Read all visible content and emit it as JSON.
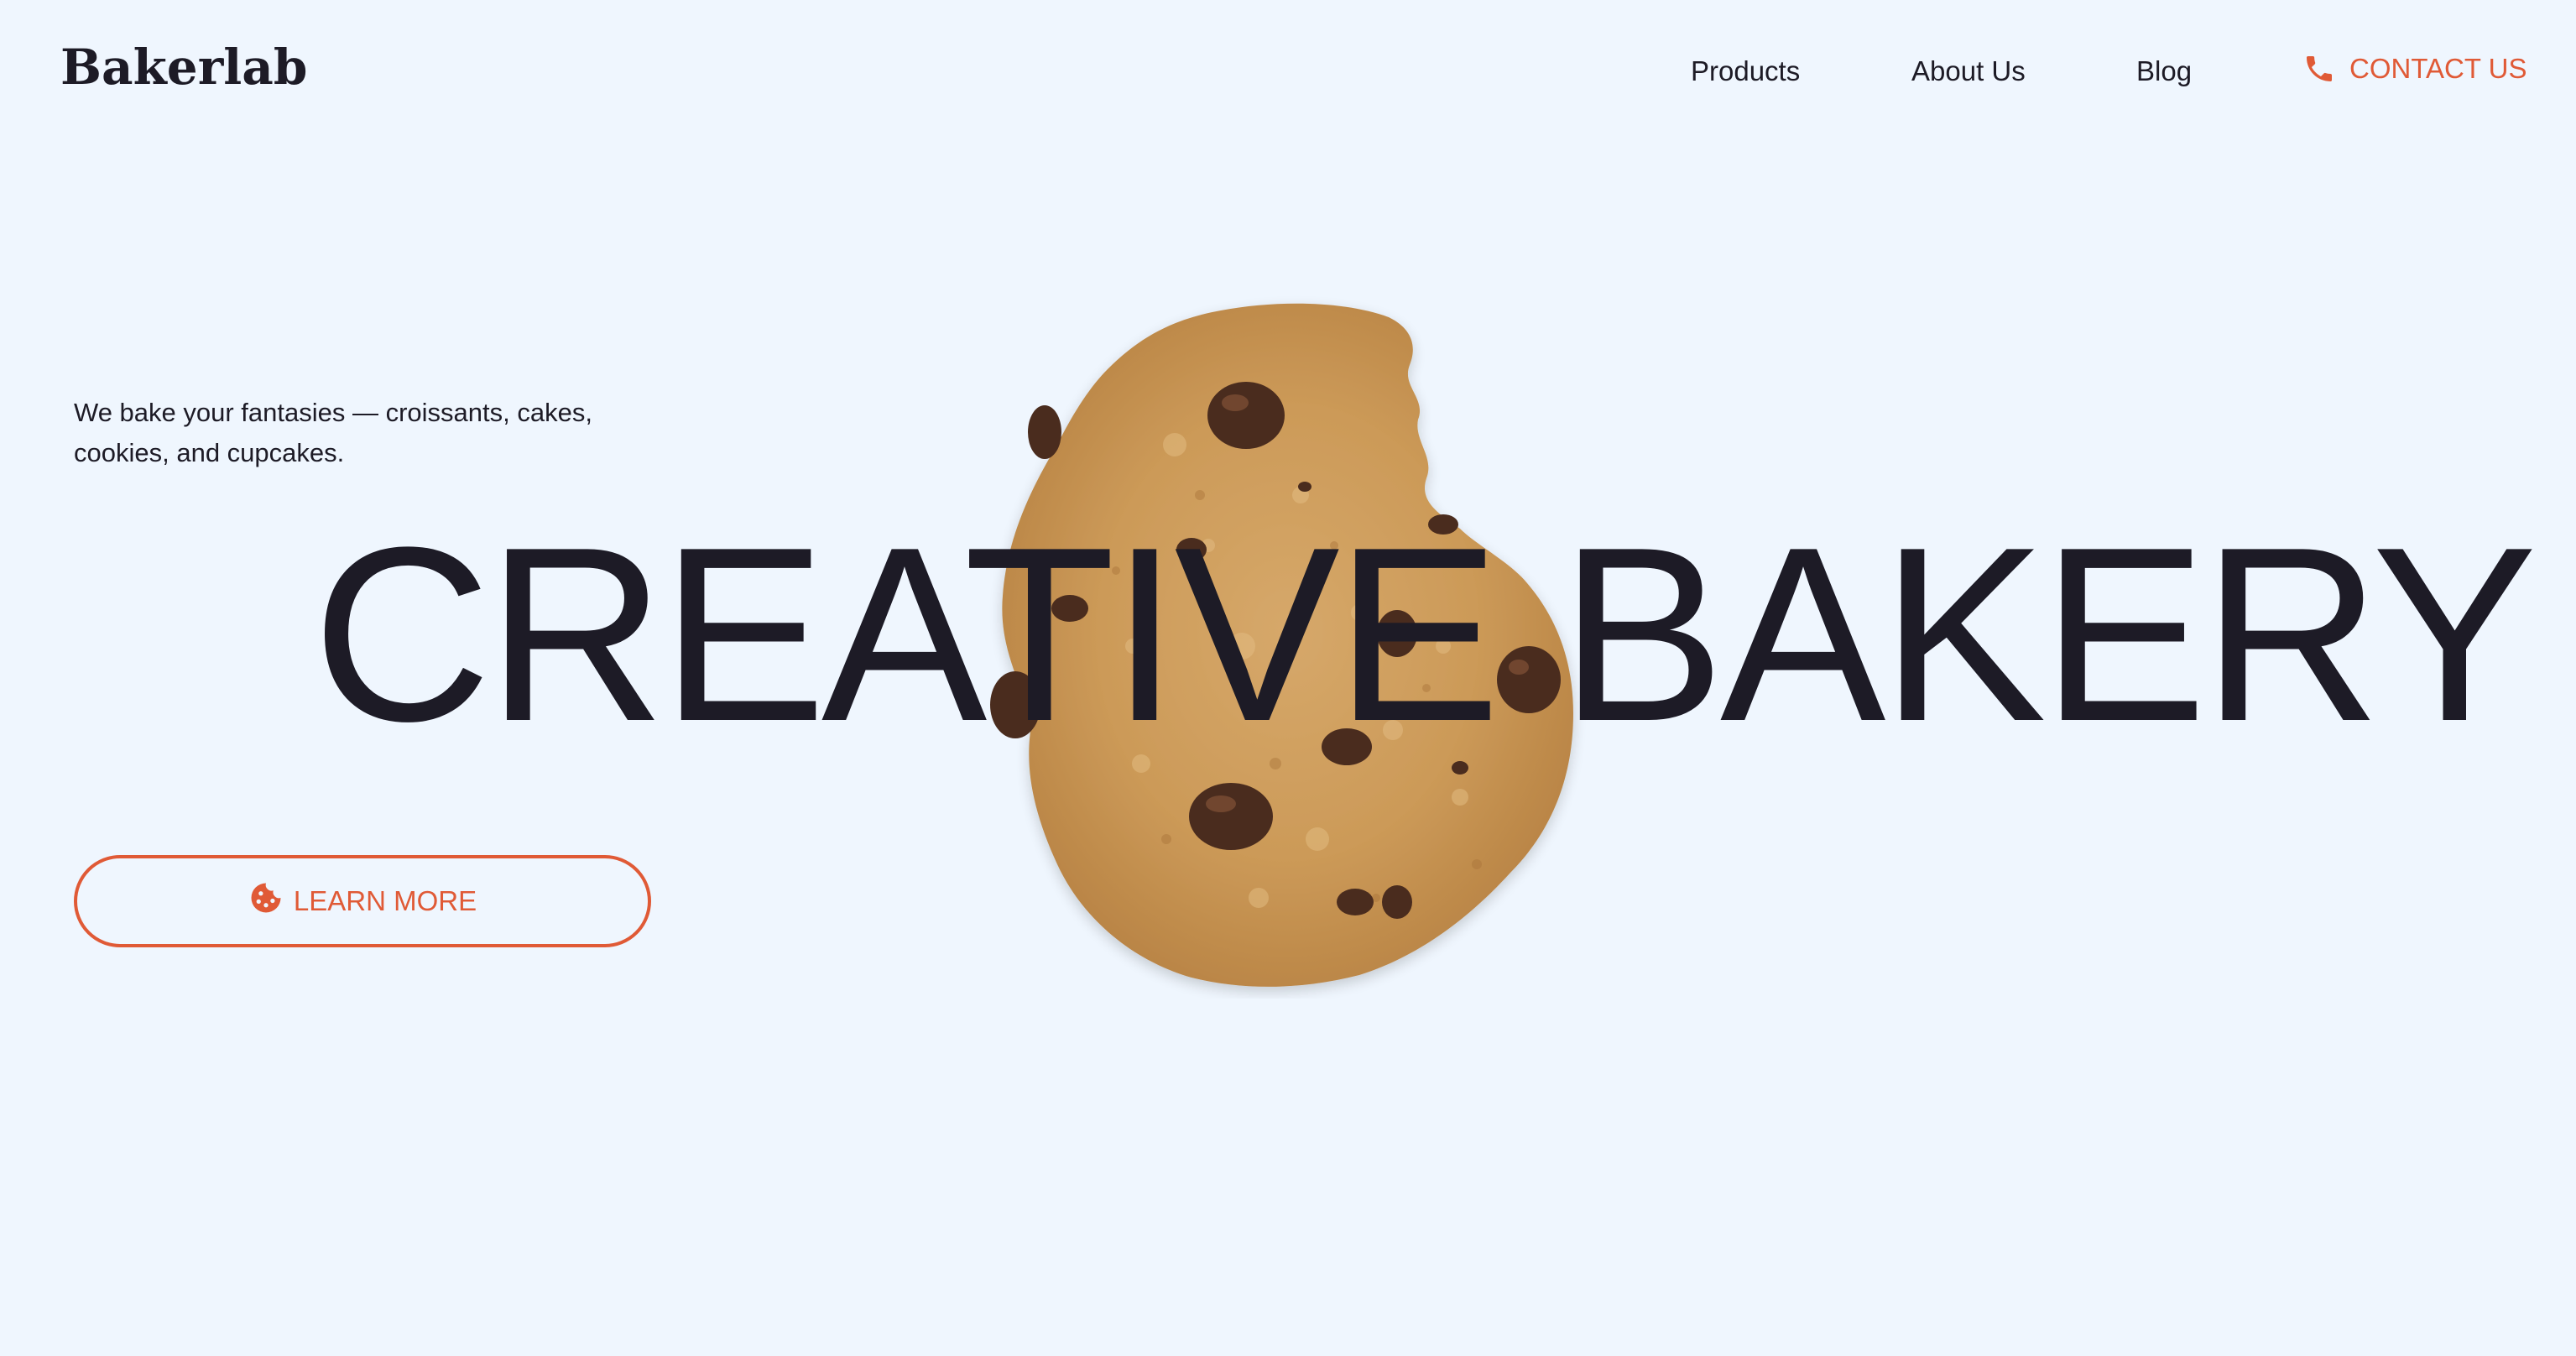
{
  "brand": {
    "logo_text": "Bakerlab"
  },
  "nav": {
    "products": "Products",
    "about": "About Us",
    "blog": "Blog",
    "contact": "CONTACT US",
    "contact_icon": "phone-icon"
  },
  "hero": {
    "tagline": "We bake your fantasies — croissants, cakes, cookies, and cupcakes.",
    "headline": "CREATIVE BAKERY",
    "cta_label": "LEARN MORE",
    "cta_icon": "cookie-icon",
    "image": "chocolate-chip-cookie"
  },
  "colors": {
    "background": "#eff6fe",
    "text": "#1d1b26",
    "accent": "#e05a36"
  }
}
